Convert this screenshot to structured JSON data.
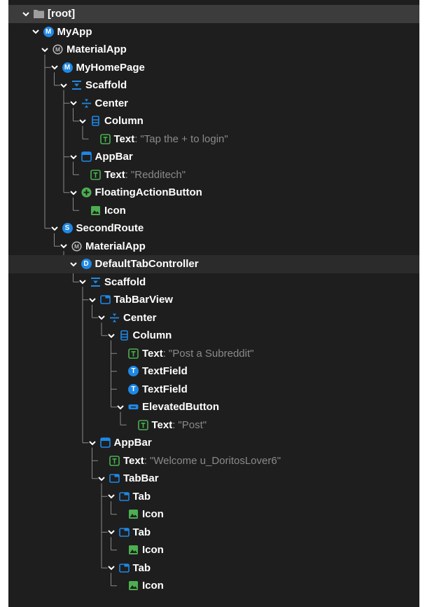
{
  "colors": {
    "background": "#1e1e1e",
    "selected_row": "#3c3c3c",
    "guide": "#8a8a8a",
    "text": "#ffffff",
    "detail_text": "#8a8a8a",
    "blue": "#1e88e5",
    "green": "#4caf50",
    "folder": "#9e9e9e"
  },
  "tree": [
    {
      "depth": 0,
      "label": "[root]",
      "icon": "folder-icon",
      "expanded": true,
      "selected": true
    },
    {
      "depth": 1,
      "label": "MyApp",
      "icon": "m-circle-icon",
      "letter": "M",
      "expanded": true
    },
    {
      "depth": 2,
      "label": "MaterialApp",
      "icon": "material-app-icon",
      "expanded": true
    },
    {
      "depth": 3,
      "label": "MyHomePage",
      "icon": "m-circle-icon",
      "letter": "M",
      "expanded": true
    },
    {
      "depth": 4,
      "label": "Scaffold",
      "icon": "scaffold-icon",
      "expanded": true
    },
    {
      "depth": 5,
      "label": "Center",
      "icon": "center-icon",
      "expanded": true
    },
    {
      "depth": 6,
      "label": "Column",
      "icon": "column-icon",
      "expanded": true
    },
    {
      "depth": 7,
      "label": "Text",
      "icon": "text-icon",
      "detail": "\"Tap the + to login\""
    },
    {
      "depth": 5,
      "label": "AppBar",
      "icon": "appbar-icon",
      "expanded": true
    },
    {
      "depth": 6,
      "label": "Text",
      "icon": "text-icon",
      "detail": "\"Redditech\""
    },
    {
      "depth": 5,
      "label": "FloatingActionButton",
      "icon": "fab-icon",
      "expanded": true
    },
    {
      "depth": 6,
      "label": "Icon",
      "icon": "image-icon"
    },
    {
      "depth": 3,
      "label": "SecondRoute",
      "icon": "s-circle-icon",
      "letter": "S",
      "expanded": true
    },
    {
      "depth": 4,
      "label": "MaterialApp",
      "icon": "material-app-icon",
      "expanded": true
    },
    {
      "depth": 5,
      "label": "DefaultTabController",
      "icon": "d-circle-icon",
      "letter": "D",
      "expanded": true,
      "highlighted": true
    },
    {
      "depth": 6,
      "label": "Scaffold",
      "icon": "scaffold-icon",
      "expanded": true
    },
    {
      "depth": 7,
      "label": "TabBarView",
      "icon": "tab-icon",
      "expanded": true
    },
    {
      "depth": 8,
      "label": "Center",
      "icon": "center-icon",
      "expanded": true
    },
    {
      "depth": 9,
      "label": "Column",
      "icon": "column-icon",
      "expanded": true
    },
    {
      "depth": 10,
      "label": "Text",
      "icon": "text-icon",
      "detail": "\"Post a Subreddit\""
    },
    {
      "depth": 10,
      "label": "TextField",
      "icon": "t-circle-icon",
      "letter": "T"
    },
    {
      "depth": 10,
      "label": "TextField",
      "icon": "t-circle-icon",
      "letter": "T"
    },
    {
      "depth": 10,
      "label": "ElevatedButton",
      "icon": "button-icon",
      "expanded": true
    },
    {
      "depth": 11,
      "label": "Text",
      "icon": "text-icon",
      "detail": "\"Post\""
    },
    {
      "depth": 7,
      "label": "AppBar",
      "icon": "appbar-icon",
      "expanded": true
    },
    {
      "depth": 8,
      "label": "Text",
      "icon": "text-icon",
      "detail": "\"Welcome u_DoritosLover6\""
    },
    {
      "depth": 8,
      "label": "TabBar",
      "icon": "tab-icon",
      "expanded": true
    },
    {
      "depth": 9,
      "label": "Tab",
      "icon": "tab-icon",
      "expanded": true
    },
    {
      "depth": 10,
      "label": "Icon",
      "icon": "image-icon"
    },
    {
      "depth": 9,
      "label": "Tab",
      "icon": "tab-icon",
      "expanded": true
    },
    {
      "depth": 10,
      "label": "Icon",
      "icon": "image-icon"
    },
    {
      "depth": 9,
      "label": "Tab",
      "icon": "tab-icon",
      "expanded": true
    },
    {
      "depth": 10,
      "label": "Icon",
      "icon": "image-icon"
    }
  ]
}
